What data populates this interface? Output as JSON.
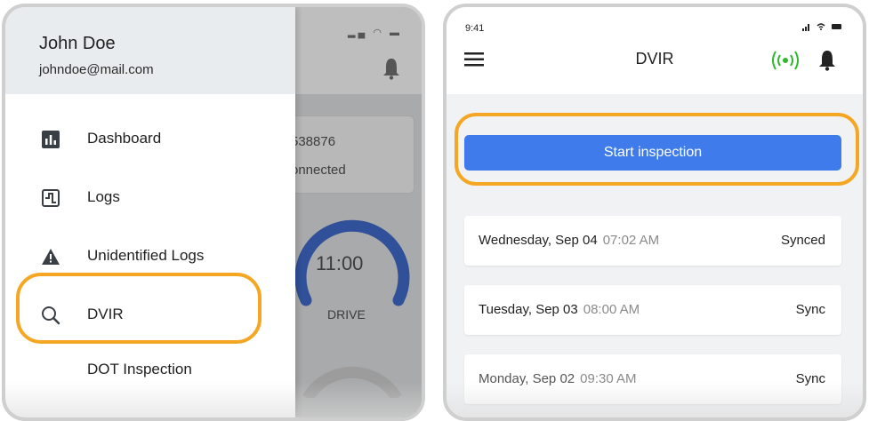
{
  "left": {
    "background": {
      "card_line1": "538876",
      "card_line2": "onnected",
      "gauge_value": "11:00",
      "gauge_label": "DRIVE"
    },
    "drawer": {
      "user_name": "John Doe",
      "user_email": "johndoe@mail.com",
      "items": [
        {
          "label": "Dashboard",
          "icon": "bar-chart-icon"
        },
        {
          "label": "Logs",
          "icon": "logs-grid-icon"
        },
        {
          "label": "Unidentified Logs",
          "icon": "warning-icon"
        },
        {
          "label": "DVIR",
          "icon": "search-icon"
        },
        {
          "label": "DOT Inspection",
          "icon": "none"
        }
      ]
    }
  },
  "right": {
    "status_time": "9:41",
    "title": "DVIR",
    "start_button": "Start inspection",
    "entries": [
      {
        "date": "Wednesday, Sep 04",
        "time": "07:02 AM",
        "status": "Synced"
      },
      {
        "date": "Tuesday, Sep 03",
        "time": "08:00 AM",
        "status": "Sync"
      },
      {
        "date": "Monday, Sep 02",
        "time": "09:30 AM",
        "status": "Sync"
      }
    ]
  },
  "colors": {
    "highlight": "#f5a623",
    "primary_button": "#3f7bea",
    "connected_green": "#2db82d"
  }
}
